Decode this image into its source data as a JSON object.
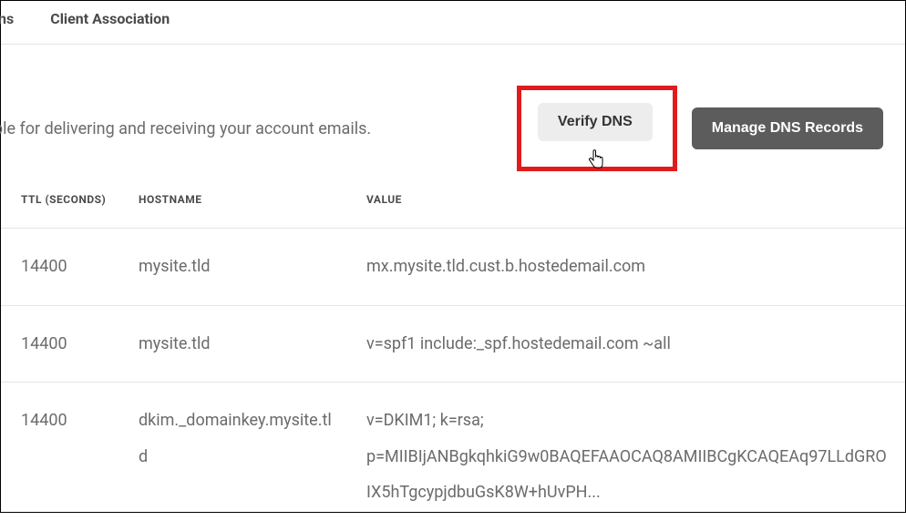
{
  "nav": {
    "tab_partial": "ons",
    "tab_client": "Client Association"
  },
  "description": "ble for delivering and receiving your account emails.",
  "buttons": {
    "verify": "Verify DNS",
    "manage": "Manage DNS Records"
  },
  "table": {
    "headers": {
      "ttl": "TTL (SECONDS)",
      "hostname": "HOSTNAME",
      "value": "VALUE"
    },
    "rows": [
      {
        "ttl": "14400",
        "hostname": "mysite.tld",
        "value": "mx.mysite.tld.cust.b.hostedemail.com"
      },
      {
        "ttl": "14400",
        "hostname": "mysite.tld",
        "value": "v=spf1 include:_spf.hostedemail.com ~all"
      },
      {
        "ttl": "14400",
        "hostname": "dkim._domainkey.mysite.tld",
        "value": "v=DKIM1; k=rsa; p=MIIBIjANBgkqhkiG9w0BAQEFAAOCAQ8AMIIBCgKCAQEAq97LLdGROIX5hTgcypjdbuGsK8W+hUvPH..."
      }
    ]
  }
}
